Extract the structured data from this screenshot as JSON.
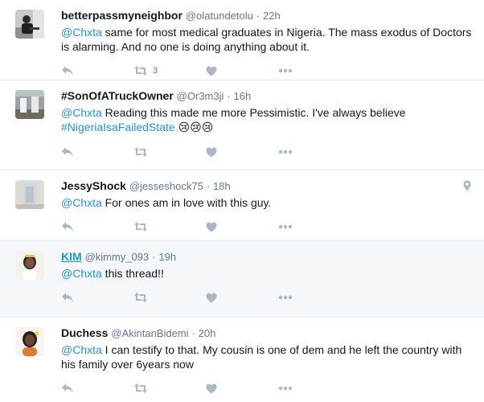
{
  "tweets": [
    {
      "fullname": "betterpassmyneighbor",
      "handle": "@olatundetolu",
      "time": "22h",
      "mention": "@Chxta",
      "text": " same for most medical graduates in Nigeria. The mass exodus of Doctors is alarming. And no one is doing anything about it.",
      "retweet_count": "3"
    },
    {
      "fullname": "#SonOfATruckOwner",
      "handle": "@Or3m3ji",
      "time": "16h",
      "mention": "@Chxta",
      "text": " Reading this made me more Pessimistic. I've always believe",
      "hashtag": "#NigeriaIsaFailedState",
      "emoji": "😢😢😢"
    },
    {
      "fullname": "JessyShock",
      "handle": "@jesseshock75",
      "time": "18h",
      "mention": "@Chxta",
      "text": " For ones am in love with this guy."
    },
    {
      "fullname": "KIM",
      "handle": "@kimmy_093",
      "time": "19h",
      "mention": "@Chxta",
      "text": " this thread!!"
    },
    {
      "fullname": "Duchess",
      "handle": "@AkintanBidemi",
      "time": "20h",
      "mention": "@Chxta",
      "text": " I can testify to that. My cousin is one of dem and he left the country with his family over 6years now"
    }
  ],
  "separator": "·",
  "icons": [
    "reply-icon",
    "retweet-icon",
    "like-icon",
    "more-icon",
    "location-pin-icon"
  ],
  "colors": {
    "link": "#1b95e0",
    "icon": "#aab8c2",
    "meta": "#657786",
    "highlight": "#f5f8fa"
  }
}
